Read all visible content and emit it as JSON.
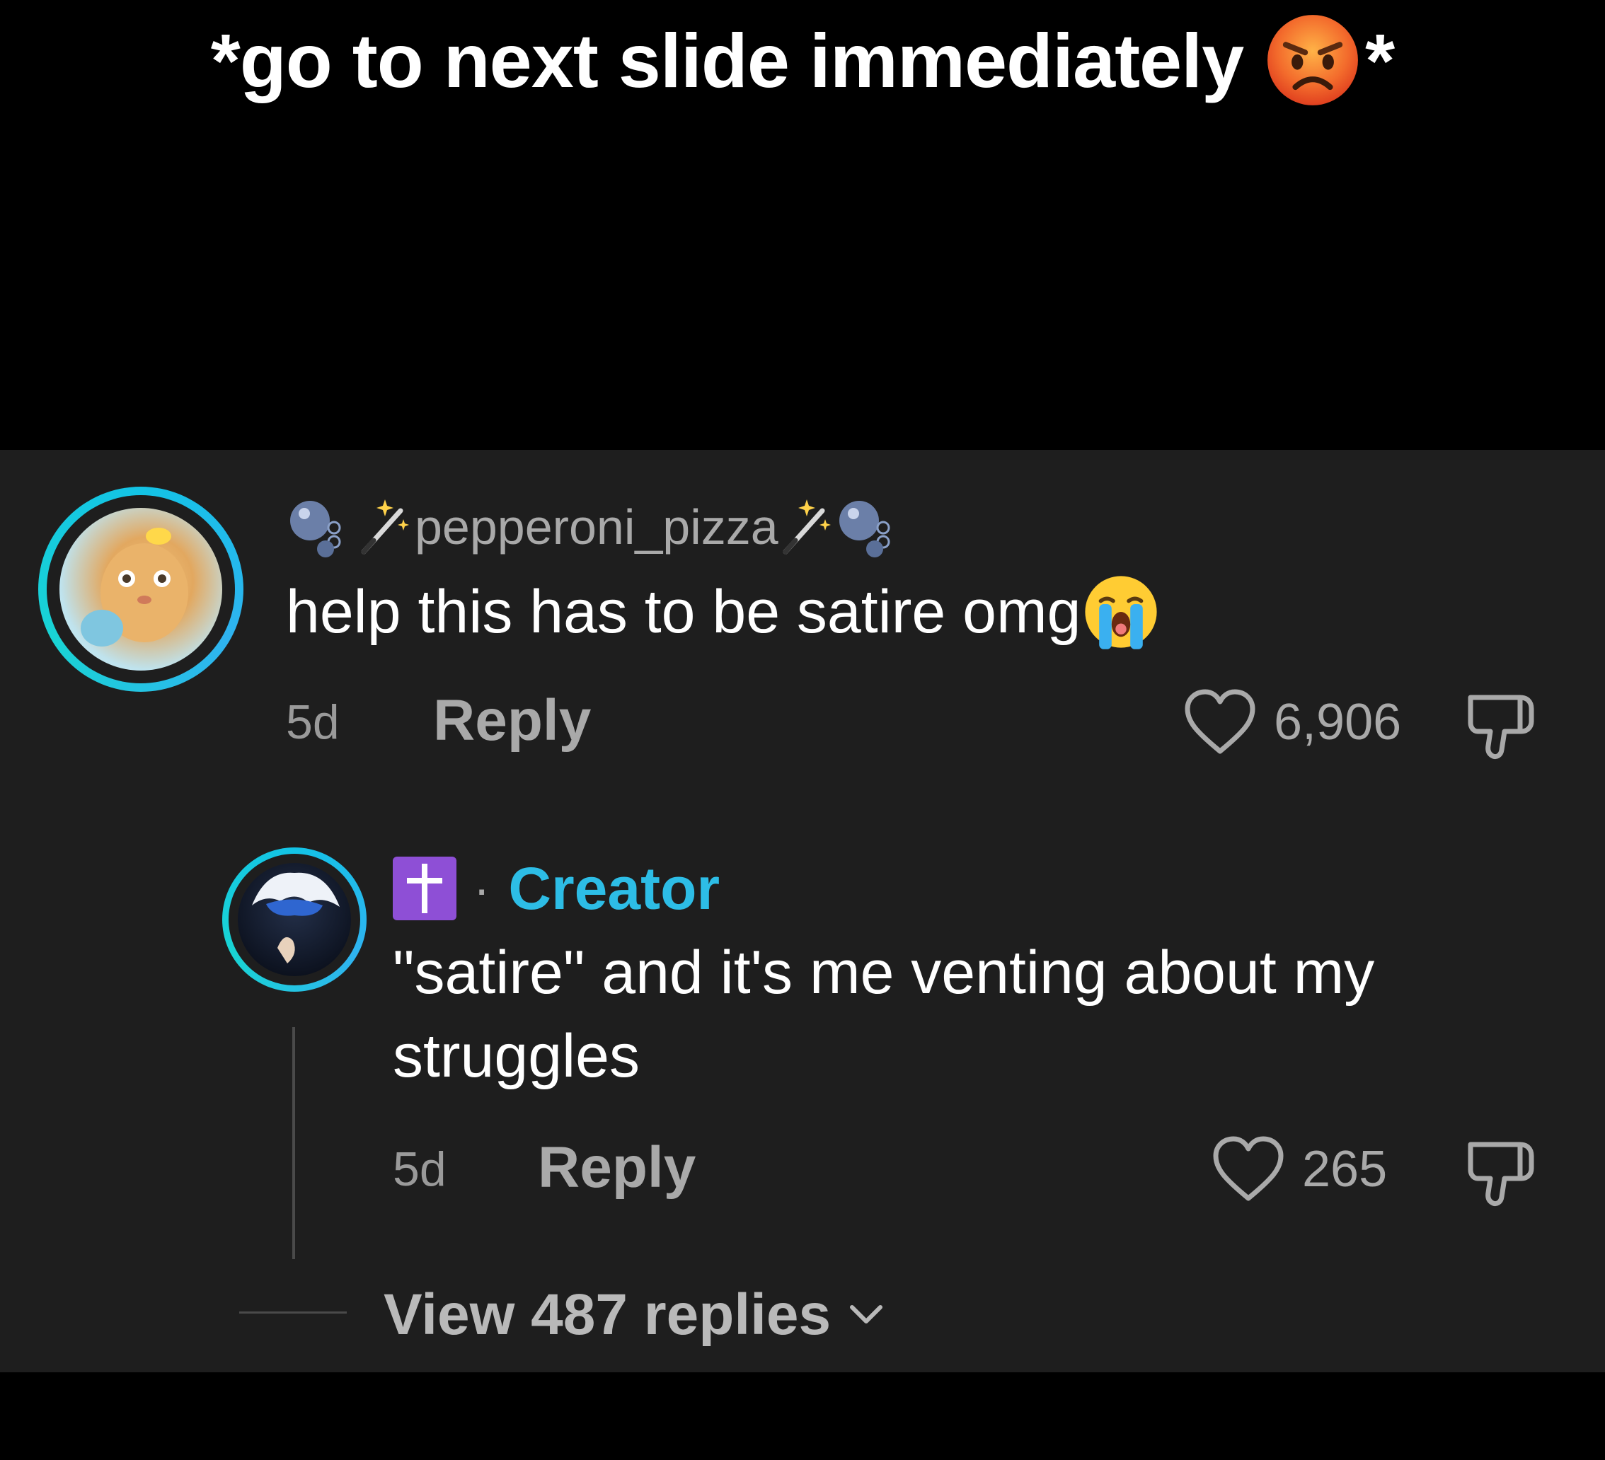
{
  "caption": {
    "text": "*go to next slide immediately",
    "suffix": "*",
    "emoji": "angry-face-emoji"
  },
  "comment": {
    "username": "pepperoni_pizza",
    "username_decorations": [
      "bubbles-emoji",
      "magic-wand-emoji"
    ],
    "text": "help this has to be satire omg",
    "text_emoji": "crying-face-emoji",
    "time": "5d",
    "reply_label": "Reply",
    "likes": "6,906"
  },
  "reply": {
    "badge_icon": "latin-cross-emoji",
    "separator": "·",
    "author_label": "Creator",
    "text_line1": "\"satire\" and it's me venting about my",
    "text_line2": "struggles",
    "time": "5d",
    "reply_label": "Reply",
    "likes": "265"
  },
  "view_replies": {
    "label": "View 487 replies",
    "icon": "chevron-down-icon"
  },
  "colors": {
    "panel_bg": "#1e1e1e",
    "accent_creator": "#2dbde6",
    "avatar_ring": "#13c3e6",
    "muted_text": "#a9a9a9"
  }
}
